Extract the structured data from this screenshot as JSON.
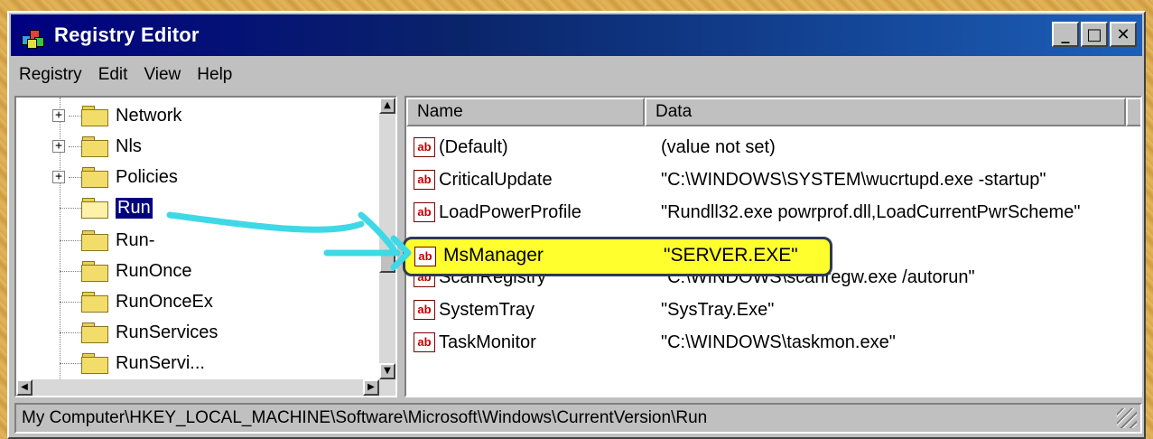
{
  "window": {
    "title": "Registry Editor",
    "app_icon": "registry-editor-icon"
  },
  "title_buttons": {
    "minimize": "_",
    "maximize": "□",
    "close": "✕"
  },
  "menu": [
    "Registry",
    "Edit",
    "View",
    "Help"
  ],
  "tree": {
    "items": [
      {
        "label": "Network",
        "expandable": true,
        "expander": "+"
      },
      {
        "label": "Nls",
        "expandable": true,
        "expander": "+"
      },
      {
        "label": "Policies",
        "expandable": true,
        "expander": "+"
      },
      {
        "label": "Run",
        "expandable": false,
        "selected": true
      },
      {
        "label": "Run-",
        "expandable": false
      },
      {
        "label": "RunOnce",
        "expandable": false
      },
      {
        "label": "RunOnceEx",
        "expandable": false
      },
      {
        "label": "RunServices",
        "expandable": false
      },
      {
        "label": "RunServi...",
        "expandable": false
      }
    ]
  },
  "list": {
    "columns": {
      "name": "Name",
      "data": "Data"
    },
    "icon_label": "ab",
    "rows": [
      {
        "name": "(Default)",
        "data": "(value not set)"
      },
      {
        "name": "CriticalUpdate",
        "data": "\"C:\\WINDOWS\\SYSTEM\\wucrtupd.exe -startup\""
      },
      {
        "name": "LoadPowerProfile",
        "data": "\"Rundll32.exe powrprof.dll,LoadCurrentPwrScheme\""
      },
      {
        "name": "MsManager",
        "data": "\"SERVER.EXE\"",
        "highlighted": true
      },
      {
        "name": "ScanRegistry",
        "data": "\"C:\\WINDOWS\\scanregw.exe /autorun\""
      },
      {
        "name": "SystemTray",
        "data": "\"SysTray.Exe\""
      },
      {
        "name": "TaskMonitor",
        "data": "\"C:\\WINDOWS\\taskmon.exe\""
      }
    ]
  },
  "status_bar": {
    "path": "My Computer\\HKEY_LOCAL_MACHINE\\Software\\Microsoft\\Windows\\CurrentVersion\\Run"
  },
  "annotation": {
    "highlight_color": "#ffff2e",
    "arrow_color": "#3fd8e6"
  }
}
